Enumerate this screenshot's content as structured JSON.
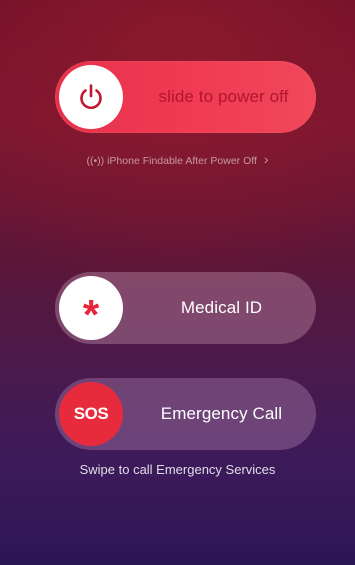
{
  "power_slider": {
    "label": "slide to power off",
    "icon": "power-icon",
    "knob_color": "#ffffff",
    "track_color": "#ee3a52",
    "label_color": "#b3152f"
  },
  "findable": {
    "icon": "antenna-icon",
    "icon_glyph": "((•))",
    "text": "iPhone Findable After Power Off",
    "chevron": "›"
  },
  "medical_slider": {
    "label": "Medical ID",
    "icon": "asterisk-icon",
    "icon_glyph": "*",
    "icon_color": "#e8243b"
  },
  "sos_slider": {
    "label": "Emergency Call",
    "knob_text": "SOS",
    "knob_color": "#e82b3c"
  },
  "swipe_hint": "Swipe to call Emergency Services"
}
